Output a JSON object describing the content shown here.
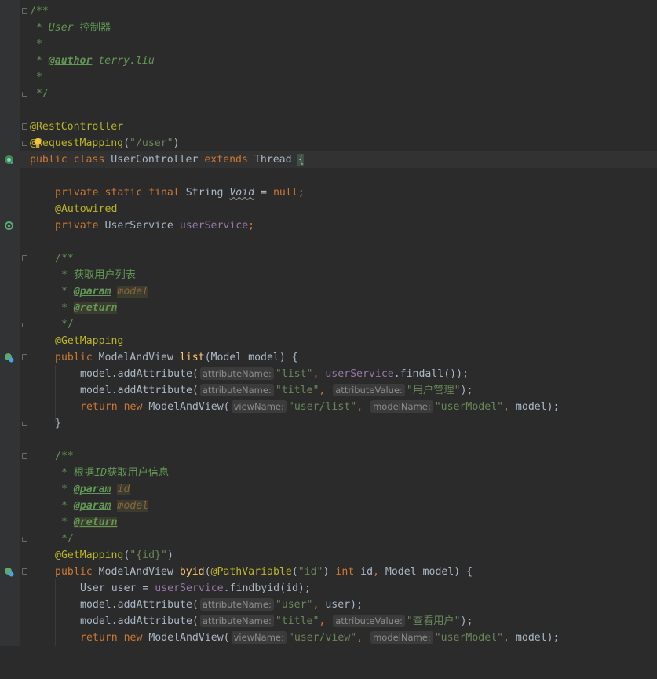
{
  "code": {
    "l1": "/**",
    "l2a": " * ",
    "l2b": "User ",
    "l2c": "控制器",
    "l3": " *",
    "l4a": " * ",
    "l4tag": "@author",
    "l4b": " terry.liu",
    "l5": " *",
    "l6": " */",
    "l8": "@RestController",
    "l9ann": "@RequestMapping",
    "l9str": "\"/user\"",
    "l10kw1": "public class",
    "l10cls": "UserController",
    "l10kw2": "extends",
    "l10sup": "Thread",
    "l12kw": "private static final",
    "l12type": "String",
    "l12var": "Void",
    "l12null": "null",
    "l13": "@Autowired",
    "l14kw": "private",
    "l14type": "UserService",
    "l14field": "userService",
    "l16": "/**",
    "l17": " * 获取用户列表",
    "l18tag": "@param",
    "l18ref": "model",
    "l19tag": "@return",
    "l20": " */",
    "l21": "@GetMapping",
    "l22kw": "public",
    "l22type": "ModelAndView",
    "l22m": "list",
    "l22params": "(Model model) {",
    "l23a": "model.addAttribute(",
    "l23hint": "attributeName:",
    "l23str": "\"list\"",
    "l23field": "userService",
    "l23b": ".findall());",
    "l24a": "model.addAttribute(",
    "l24hint1": "attributeName:",
    "l24str1": "\"title\"",
    "l24hint2": "attributeValue:",
    "l24str2": "\"用户管理\"",
    "l25kw": "return new",
    "l25a": "ModelAndView(",
    "l25hint1": "viewName:",
    "l25str1": "\"user/list\"",
    "l25hint2": "modelName:",
    "l25str2": "\"userModel\"",
    "l25b": "model);",
    "l26": "}",
    "l28": "/**",
    "l29a": " * 根据",
    "l29b": "ID",
    "l29c": "获取用户信息",
    "l30tag": "@param",
    "l30ref": "id",
    "l31tag": "@param",
    "l31ref": "model",
    "l32tag": "@return",
    "l33": " */",
    "l34ann": "@GetMapping",
    "l34str": "\"{id}\"",
    "l35kw": "public",
    "l35type": "ModelAndView",
    "l35m": "byid",
    "l35ann": "@PathVariable",
    "l35str": "\"id\"",
    "l35int": "int",
    "l35rest": "Model model) {",
    "l36a": "User user = ",
    "l36field": "userService",
    "l36b": ".findbyid(id);",
    "l37a": "model.addAttribute(",
    "l37hint": "attributeName:",
    "l37str": "\"user\"",
    "l37b": "user);",
    "l38a": "model.addAttribute(",
    "l38hint1": "attributeName:",
    "l38str1": "\"title\"",
    "l38hint2": "attributeValue:",
    "l38str2": "\"查看用户\"",
    "l39kw": "return new",
    "l39a": "ModelAndView(",
    "l39hint1": "viewName:",
    "l39str1": "\"user/view\"",
    "l39hint2": "modelName:",
    "l39str2": "\"userModel\"",
    "l39b": "model);"
  },
  "gutter_icons": [
    "bean-class-icon",
    "autowired-bean-icon",
    "request-mapping-icon",
    "request-mapping-icon"
  ],
  "colors": {
    "background": "#2b2b2b",
    "keyword": "#cc7832",
    "annotation": "#bbb529",
    "string": "#6a8759",
    "doc": "#629755",
    "field": "#9876aa",
    "method": "#ffc66d"
  }
}
